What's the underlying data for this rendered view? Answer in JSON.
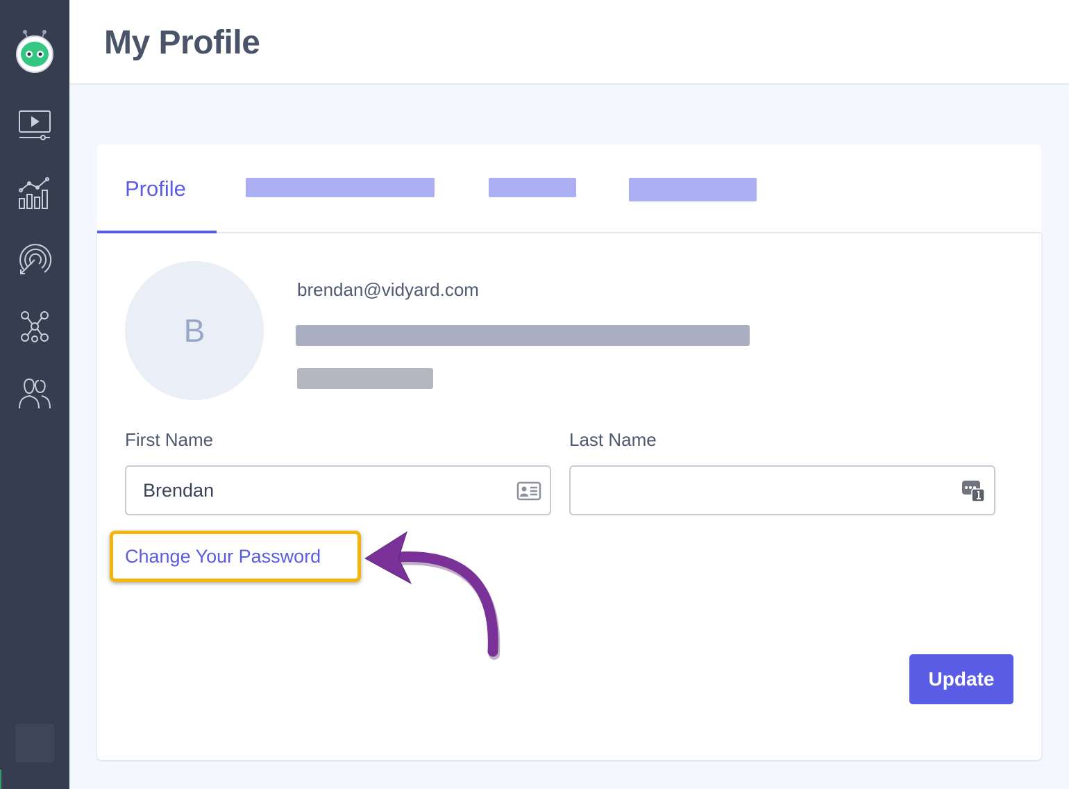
{
  "header": {
    "title": "My Profile"
  },
  "sidebar": {
    "logo": "robot-logo-icon",
    "items": [
      {
        "name": "video-library-icon"
      },
      {
        "name": "analytics-icon"
      },
      {
        "name": "target-icon"
      },
      {
        "name": "integrations-icon"
      },
      {
        "name": "team-icon"
      }
    ]
  },
  "tabs": [
    {
      "label": "Profile",
      "active": true
    }
  ],
  "profile": {
    "avatar_initial": "B",
    "email": "brendan@vidyard.com"
  },
  "form": {
    "first_name_label": "First Name",
    "first_name_value": "Brendan",
    "last_name_label": "Last Name",
    "last_name_value": "",
    "change_password_label": "Change Your Password",
    "update_label": "Update"
  },
  "colors": {
    "accent": "#5b5ce6",
    "sidebar": "#353d4f",
    "highlight": "#f3b40d",
    "annotation_arrow": "#7a3299",
    "redacted_tab": "#adaff4",
    "redacted_text": "#a9aec0"
  }
}
